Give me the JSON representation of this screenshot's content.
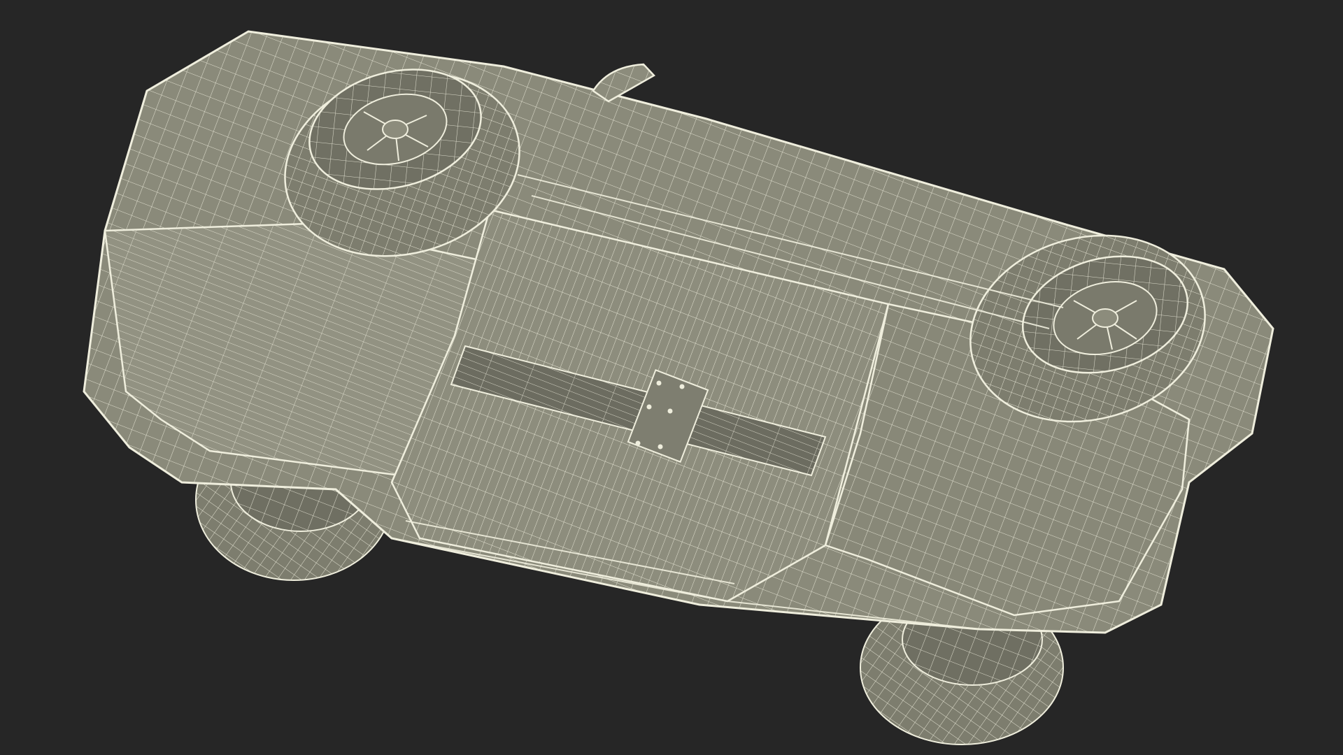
{
  "scene": {
    "subject": "car-underside-wireframe",
    "colors": {
      "background": "#262626",
      "surface": "#8c8c7c",
      "surface_dark": "#6f6f62",
      "surface_light": "#9b9b8b",
      "wire": "#efeedd",
      "rim": "#7a7a6c"
    }
  }
}
